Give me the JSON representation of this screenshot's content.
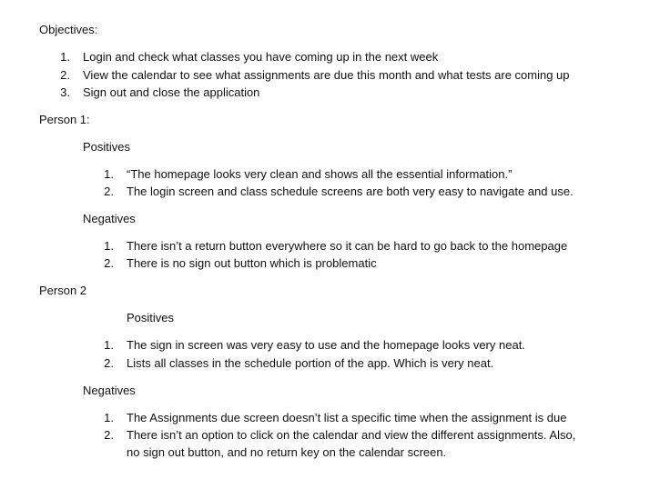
{
  "objectives": {
    "heading": "Objectives:",
    "items": [
      {
        "num": "1.",
        "text": "Login and check what classes you have coming up in the next week"
      },
      {
        "num": "2.",
        "text": "View the calendar to see what assignments are due this month and what tests are coming up"
      },
      {
        "num": "3.",
        "text": "Sign out and close the application"
      }
    ]
  },
  "person1": {
    "heading": "Person 1:",
    "positives": {
      "heading": "Positives",
      "items": [
        {
          "num": "1.",
          "text": "“The homepage looks very clean and shows all the essential information.”"
        },
        {
          "num": "2.",
          "text": "The login screen and class schedule screens are both very easy to navigate and use."
        }
      ]
    },
    "negatives": {
      "heading": "Negatives",
      "items": [
        {
          "num": "1.",
          "text": "There isn’t a return button everywhere so it can be hard to go back to the homepage"
        },
        {
          "num": "2.",
          "text": "There is no sign out button which is problematic"
        }
      ]
    }
  },
  "person2": {
    "heading": "Person 2",
    "positives": {
      "heading": "Positives",
      "items": [
        {
          "num": "1.",
          "text": "The sign in screen was very easy to use and the homepage looks very neat."
        },
        {
          "num": "2.",
          "text": "Lists all classes in the schedule portion of the app. Which is very neat."
        }
      ]
    },
    "negatives": {
      "heading": "Negatives",
      "items": [
        {
          "num": "1.",
          "text": "The Assignments due screen doesn’t list a specific time when the assignment is due"
        },
        {
          "num": "2.",
          "text": "There isn’t an option to click on the calendar and view the different assignments. Also,",
          "continuation": "no sign out button, and no return key on the calendar screen."
        }
      ]
    }
  }
}
